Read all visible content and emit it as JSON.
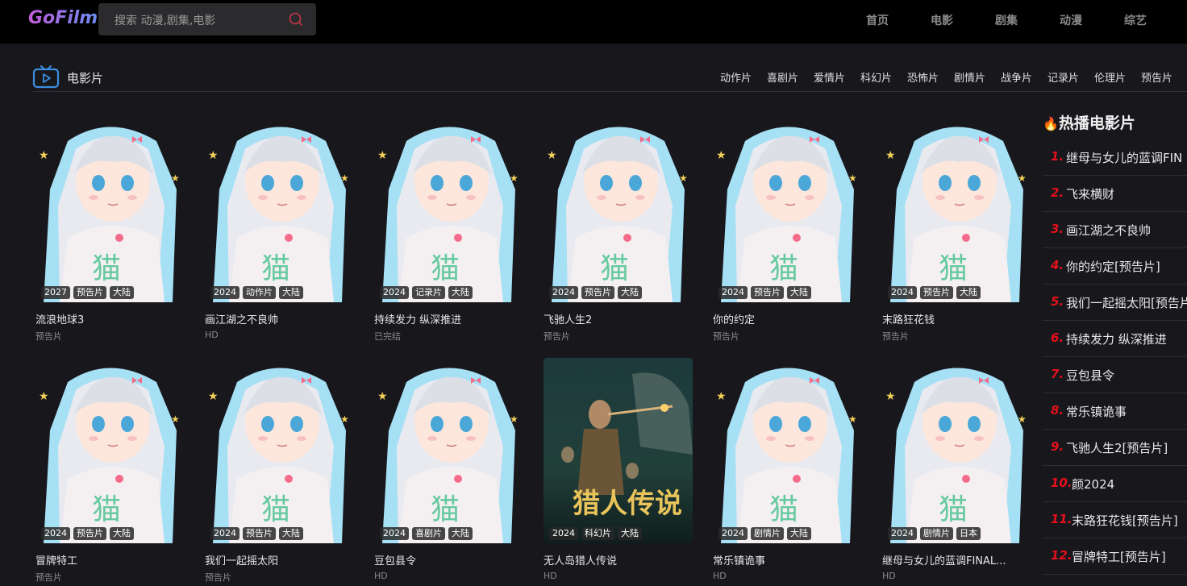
{
  "header": {
    "logo": "GoFilm",
    "search_placeholder": "搜索 动漫,剧集,电影",
    "nav": [
      "首页",
      "电影",
      "剧集",
      "动漫",
      "综艺"
    ]
  },
  "section": {
    "title": "电影片",
    "categories": [
      "动作片",
      "喜剧片",
      "爱情片",
      "科幻片",
      "恐怖片",
      "剧情片",
      "战争片",
      "记录片",
      "伦理片",
      "预告片"
    ]
  },
  "movies": [
    {
      "title": "流浪地球3",
      "status": "预告片",
      "tags": [
        "2027",
        "预告片",
        "大陆"
      ],
      "poster": "anime"
    },
    {
      "title": "画江湖之不良帅",
      "status": "HD",
      "tags": [
        "2024",
        "动作片",
        "大陆"
      ],
      "poster": "anime"
    },
    {
      "title": "持续发力 纵深推进",
      "status": "已完结",
      "tags": [
        "2024",
        "记录片",
        "大陆"
      ],
      "poster": "anime"
    },
    {
      "title": "飞驰人生2",
      "status": "预告片",
      "tags": [
        "2024",
        "预告片",
        "大陆"
      ],
      "poster": "anime"
    },
    {
      "title": "你的约定",
      "status": "预告片",
      "tags": [
        "2024",
        "预告片",
        "大陆"
      ],
      "poster": "anime"
    },
    {
      "title": "末路狂花钱",
      "status": "预告片",
      "tags": [
        "2024",
        "预告片",
        "大陆"
      ],
      "poster": "anime"
    },
    {
      "title": "冒牌特工",
      "status": "预告片",
      "tags": [
        "2024",
        "预告片",
        "大陆"
      ],
      "poster": "anime"
    },
    {
      "title": "我们一起摇太阳",
      "status": "预告片",
      "tags": [
        "2024",
        "预告片",
        "大陆"
      ],
      "poster": "anime"
    },
    {
      "title": "豆包县令",
      "status": "HD",
      "tags": [
        "2024",
        "喜剧片",
        "大陆"
      ],
      "poster": "anime"
    },
    {
      "title": "无人岛猎人传说",
      "status": "HD",
      "tags": [
        "2024",
        "科幻片",
        "大陆"
      ],
      "poster": "photo",
      "poster_text": "猎人传说"
    },
    {
      "title": "常乐镇诡事",
      "status": "HD",
      "tags": [
        "2024",
        "剧情片",
        "大陆"
      ],
      "poster": "anime"
    },
    {
      "title": "继母与女儿的蓝调FINAL...",
      "status": "HD",
      "tags": [
        "2024",
        "剧情片",
        "日本"
      ],
      "poster": "anime"
    }
  ],
  "hot": {
    "title": "热播电影片",
    "items": [
      {
        "num": "1.",
        "name": "继母与女儿的蓝调FIN"
      },
      {
        "num": "2.",
        "name": "飞来横财"
      },
      {
        "num": "3.",
        "name": "画江湖之不良帅"
      },
      {
        "num": "4.",
        "name": "你的约定[预告片]"
      },
      {
        "num": "5.",
        "name": "我们一起摇太阳[预告片"
      },
      {
        "num": "6.",
        "name": "持续发力 纵深推进"
      },
      {
        "num": "7.",
        "name": "豆包县令"
      },
      {
        "num": "8.",
        "name": "常乐镇诡事"
      },
      {
        "num": "9.",
        "name": "飞驰人生2[预告片]"
      },
      {
        "num": "10.",
        "name": "颜2024"
      },
      {
        "num": "11.",
        "name": "末路狂花钱[预告片]"
      },
      {
        "num": "12.",
        "name": "冒牌特工[预告片]"
      }
    ]
  },
  "colors": {
    "accent": "#e6101c",
    "page_bg": "#18171c",
    "header_bg": "#000000"
  }
}
